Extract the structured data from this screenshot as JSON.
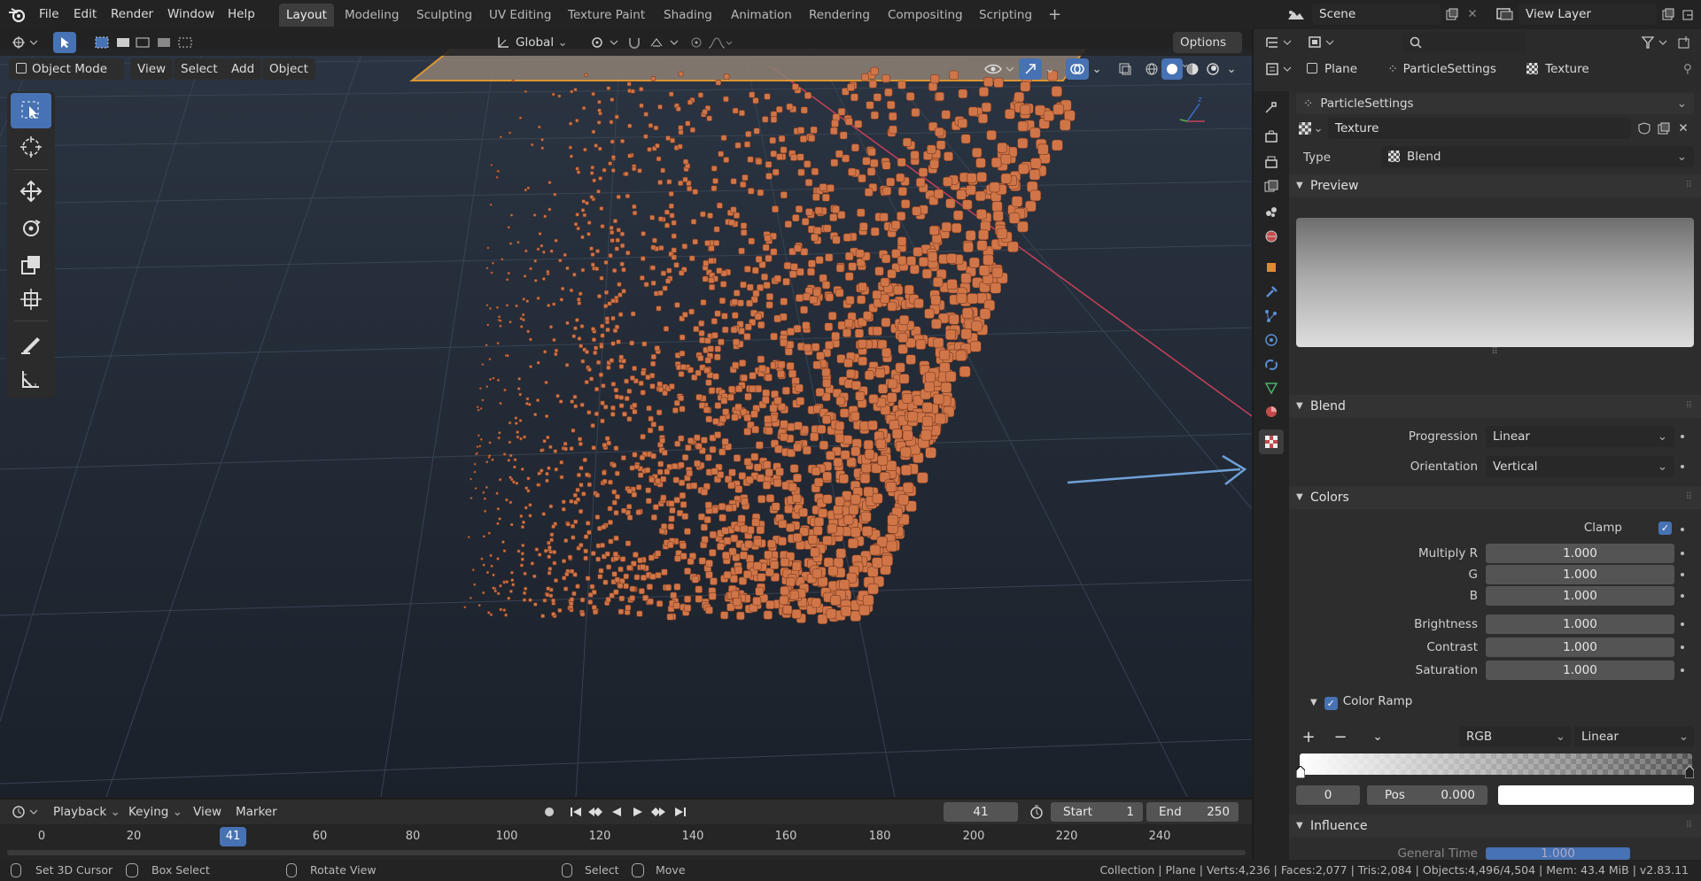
{
  "menu": [
    "File",
    "Edit",
    "Render",
    "Window",
    "Help"
  ],
  "workspaces": [
    "Layout",
    "Modeling",
    "Sculpting",
    "UV Editing",
    "Texture Paint",
    "Shading",
    "Animation",
    "Rendering",
    "Compositing",
    "Scripting"
  ],
  "active_workspace": "Layout",
  "add_workspace": "+",
  "scene": "Scene",
  "view_layer": "View Layer",
  "viewport_header": {
    "orientation": "Global",
    "options": "Options",
    "mode": "Object Mode",
    "menus": [
      "View",
      "Select",
      "Add",
      "Object"
    ]
  },
  "tools": [
    "cursor-select",
    "3d-cursor",
    "move",
    "rotate",
    "scale",
    "transform",
    "annotate",
    "measure"
  ],
  "properties": {
    "breadcrumb": [
      "Plane",
      "ParticleSettings",
      "Texture"
    ],
    "particle_settings": "ParticleSettings",
    "texture_name": "Texture",
    "type_label": "Type",
    "type_value": "Blend",
    "preview_header": "Preview",
    "blend_header": "Blend",
    "progression_label": "Progression",
    "progression_value": "Linear",
    "orientation_label": "Orientation",
    "orientation_value": "Vertical",
    "colors_header": "Colors",
    "clamp_label": "Clamp",
    "clamp_checked": true,
    "multiply_r_label": "Multiply R",
    "g_label": "G",
    "b_label": "B",
    "multiply_r": "1.000",
    "g": "1.000",
    "b": "1.000",
    "brightness_label": "Brightness",
    "contrast_label": "Contrast",
    "saturation_label": "Saturation",
    "brightness": "1.000",
    "contrast": "1.000",
    "saturation": "1.000",
    "color_ramp_label": "Color Ramp",
    "ramp_mode": "RGB",
    "ramp_interp": "Linear",
    "ramp_index": "0",
    "pos_label": "Pos",
    "pos_value": "0.000",
    "influence_header": "Influence",
    "general_time_label": "General Time",
    "general_time_value": "1.000"
  },
  "timeline": {
    "menus": [
      "Playback",
      "Keying",
      "View",
      "Marker"
    ],
    "current_frame": "41",
    "start_label": "Start",
    "start": "1",
    "end_label": "End",
    "end": "250",
    "ticks": [
      "0",
      "20",
      "41",
      "60",
      "80",
      "100",
      "120",
      "140",
      "160",
      "180",
      "200",
      "220",
      "240"
    ]
  },
  "status": {
    "hints": [
      "Set 3D Cursor",
      "Box Select",
      "Rotate View",
      "Select",
      "Move"
    ],
    "info": "Collection | Plane | Verts:4,236 | Faces:2,077 | Tris:2,084 | Objects:4,496/4,504 | Mem: 43.4 MiB | v2.83.11"
  },
  "colors": {
    "accent": "#4772b3",
    "particle": "#d9805a",
    "x_axis": "#c8405a",
    "annotation_arrow": "#6fa0d8"
  }
}
